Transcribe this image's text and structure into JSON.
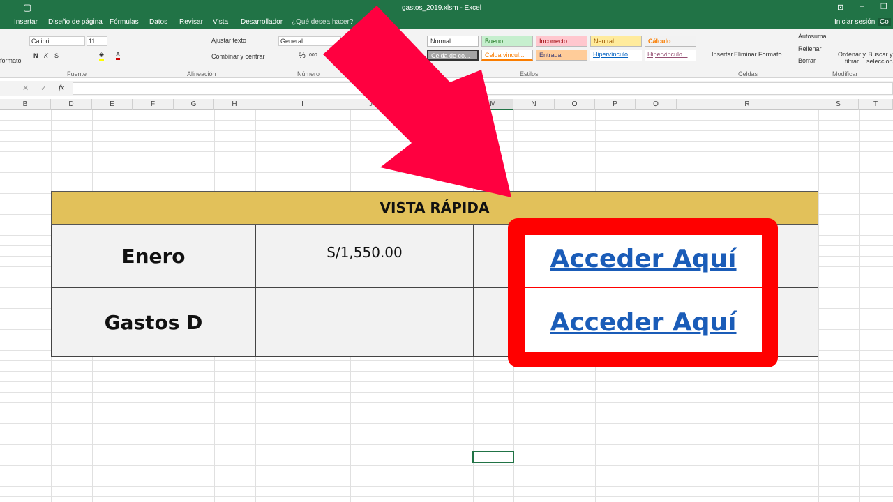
{
  "window": {
    "title": "gastos_2019.xlsm - Excel"
  },
  "tabs": [
    "Insertar",
    "Diseño de página",
    "Fórmulas",
    "Datos",
    "Revisar",
    "Vista",
    "Desarrollador"
  ],
  "tell_me": "¿Qué desea hacer?",
  "signin": "Iniciar sesión",
  "share": "Co",
  "ribbon": {
    "formato": "formato",
    "font": "Calibri",
    "size": "11",
    "bold": "N",
    "italic": "K",
    "underline": "S",
    "wrap": "Ajustar texto",
    "merge": "Combinar y centrar",
    "number_format": "General",
    "percent": "%",
    "thousands": "000",
    "groups": [
      "Fuente",
      "Alineación",
      "Número",
      "Estilos",
      "Celdas",
      "Modificar"
    ],
    "styles": [
      {
        "label": "Normal",
        "bg": "#ffffff",
        "color": "#000000"
      },
      {
        "label": "Bueno",
        "bg": "#c6efce",
        "color": "#006100"
      },
      {
        "label": "Incorrecto",
        "bg": "#ffc7ce",
        "color": "#9c0006"
      },
      {
        "label": "Neutral",
        "bg": "#ffeb9c",
        "color": "#9c5700"
      },
      {
        "label": "Cálculo",
        "bg": "#f2f2f2",
        "color": "#fa7d00"
      },
      {
        "label": "Celda de co...",
        "bg": "#a5a5a5",
        "color": "#ffffff"
      },
      {
        "label": "Celda vincul...",
        "bg": "#ffffff",
        "color": "#fa7d00"
      },
      {
        "label": "Entrada",
        "bg": "#ffcc99",
        "color": "#3f3f76"
      },
      {
        "label": "Hipervínculo",
        "bg": "#ffffff",
        "color": "#0563c1"
      },
      {
        "label": "Hipervínculo...",
        "bg": "#ffffff",
        "color": "#954f72"
      }
    ],
    "cells": [
      "Insertar",
      "Eliminar",
      "Formato"
    ],
    "edit": [
      "Autosuma",
      "Rellenar",
      "Borrar",
      "Ordenar y filtrar",
      "Buscar y seleccionar"
    ]
  },
  "formula_bar": {
    "fx": "fx",
    "cancel": "✕",
    "enter": "✓"
  },
  "columns": [
    "B",
    "D",
    "E",
    "F",
    "G",
    "H",
    "I",
    "J",
    "M",
    "N",
    "O",
    "P",
    "Q",
    "R",
    "S",
    "T"
  ],
  "sheet": {
    "header": "VISTA RÁPIDA",
    "rows": [
      {
        "label": "Enero",
        "value": "S/1,550.00",
        "link": "Acceder Aquí"
      },
      {
        "label": "Gastos D",
        "value": "",
        "link": "Acceder Aquí"
      }
    ]
  },
  "colors": {
    "excel_green": "#217346",
    "header_fill": "#e2c15a",
    "highlight_box": "#ff0000",
    "arrow": "#ff0040",
    "link": "#1a5cb8"
  }
}
